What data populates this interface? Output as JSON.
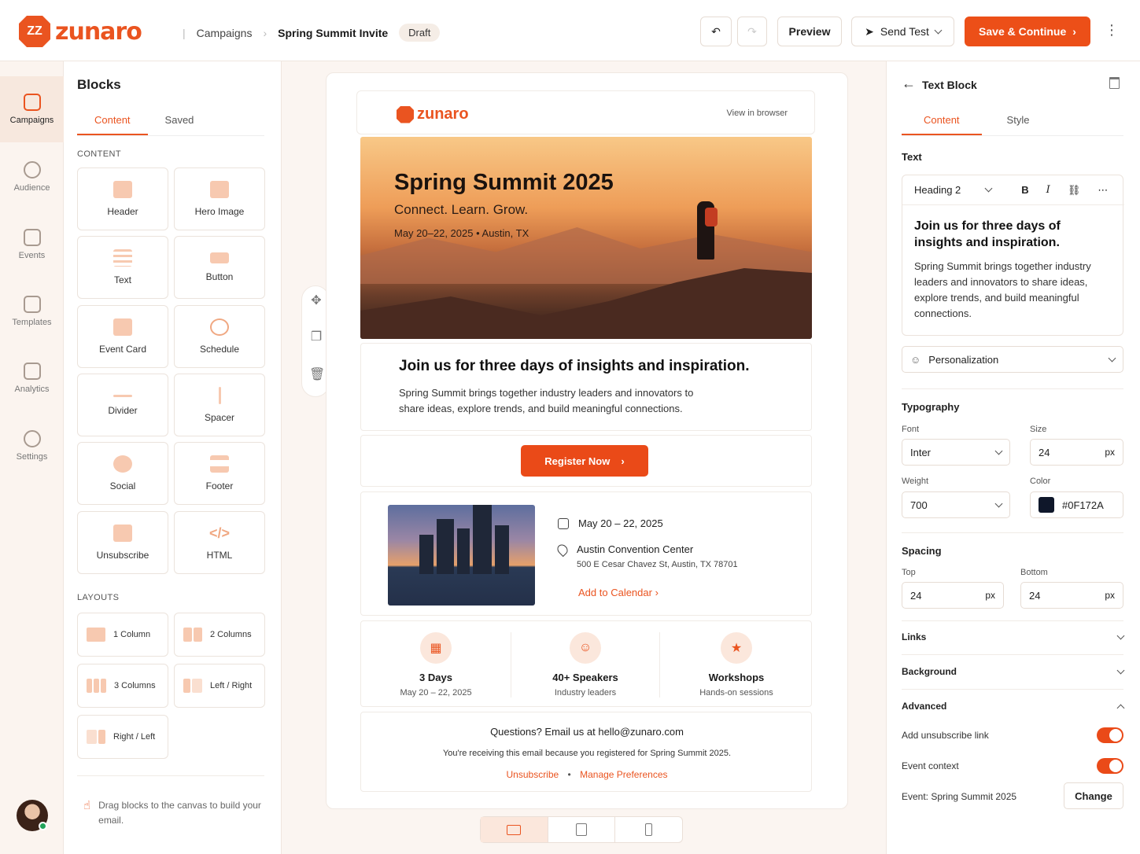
{
  "brand": {
    "name": "zunaro",
    "accent": "#EA5420"
  },
  "breadcrumb": {
    "parent": "Campaigns",
    "current": "Spring Summit Invite",
    "status": "Draft"
  },
  "toolbar": {
    "preview": "Preview",
    "send_test": "Send Test",
    "save": "Save & Continue"
  },
  "rail": [
    {
      "label": "Campaigns",
      "icon": "campaigns-icon",
      "active": true
    },
    {
      "label": "Audience",
      "icon": "audience-icon"
    },
    {
      "label": "Events",
      "icon": "calendar-icon"
    },
    {
      "label": "Templates",
      "icon": "template-icon"
    },
    {
      "label": "Analytics",
      "icon": "analytics-icon"
    },
    {
      "label": "Settings",
      "icon": "gear-icon"
    }
  ],
  "blocks": {
    "title": "Blocks",
    "tabs": [
      "Content",
      "Saved"
    ],
    "content_label": "CONTENT",
    "items": [
      "Header",
      "Hero Image",
      "Text",
      "Button",
      "Event Card",
      "Schedule",
      "Divider",
      "Spacer",
      "Social",
      "Footer",
      "Unsubscribe",
      "HTML"
    ],
    "layouts_label": "LAYOUTS",
    "layouts": [
      "1 Column",
      "2 Columns",
      "3 Columns",
      "Left / Right",
      "Right / Left"
    ],
    "hint": "Drag blocks to the canvas to build your email."
  },
  "email": {
    "view_browser": "View in browser",
    "hero_title": "Spring Summit 2025",
    "hero_sub": "Connect. Learn. Grow.",
    "hero_meta": "May 20–22, 2025  •  Austin, TX",
    "intro_heading": "Join us for three days of insights and inspiration.",
    "intro_body": "Spring Summit brings together industry leaders and innovators to share ideas, explore trends, and build meaningful connections.",
    "cta": "Register Now",
    "event_date": "May 20 – 22, 2025",
    "venue": "Austin Convention Center",
    "address": "500 E Cesar Chavez St, Austin, TX 78701",
    "add_calendar": "Add to Calendar",
    "stats": [
      {
        "title": "3 Days",
        "sub": "May 20 – 22, 2025"
      },
      {
        "title": "40+ Speakers",
        "sub": "Industry leaders"
      },
      {
        "title": "Workshops",
        "sub": "Hands-on sessions"
      }
    ],
    "footer_q": "Questions? Email us at hello@zunaro.com",
    "footer_note": "You're receiving this email because you registered for Spring Summit 2025.",
    "footer_unsub": "Unsubscribe",
    "footer_prefs": "Manage Preferences"
  },
  "props": {
    "title": "Text Block",
    "tabs": [
      "Content",
      "Style"
    ],
    "text_label": "Text",
    "style_select": "Heading 2",
    "editor_heading": "Join us for three days of insights and inspiration.",
    "editor_body": "Spring Summit brings together industry leaders and innovators to share ideas, explore trends, and build meaningful connections.",
    "personalization": "Personalization",
    "typography": "Typography",
    "font_label": "Font",
    "font": "Inter",
    "size_label": "Size",
    "size": "24",
    "size_unit": "px",
    "weight_label": "Weight",
    "weight": "700",
    "color_label": "Color",
    "color": "#0F172A",
    "spacing": "Spacing",
    "top_label": "Top",
    "top": "24",
    "top_unit": "px",
    "bottom_label": "Bottom",
    "bottom": "24",
    "bottom_unit": "px",
    "links": "Links",
    "background": "Background",
    "advanced": "Advanced",
    "unsub_toggle": "Add unsubscribe link",
    "event_toggle": "Event context",
    "event_name": "Event: Spring Summit 2025",
    "change": "Change"
  }
}
